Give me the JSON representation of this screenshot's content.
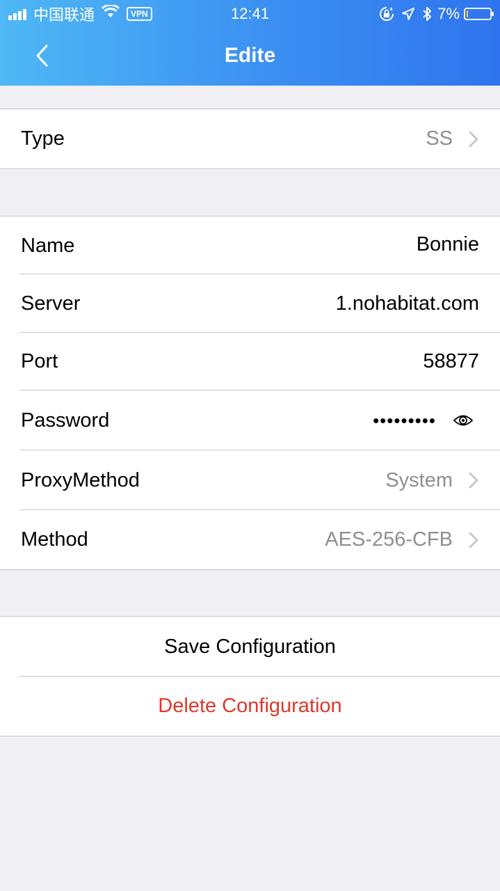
{
  "status_bar": {
    "carrier": "中国联通",
    "vpn": "VPN",
    "time": "12:41",
    "battery": "7%",
    "battery_level": 0.07,
    "battery_color": "#f7d341"
  },
  "nav": {
    "title": "Edite",
    "back_icon": "chevron-left-icon"
  },
  "type_row": {
    "label": "Type",
    "value": "SS"
  },
  "fields": {
    "name": {
      "label": "Name",
      "value": "Bonnie"
    },
    "server": {
      "label": "Server",
      "value": "1.nohabitat.com"
    },
    "port": {
      "label": "Port",
      "value": "58877"
    },
    "password": {
      "label": "Password",
      "value": "•••••••••",
      "toggle_icon": "eye-icon"
    },
    "proxy_method": {
      "label": "ProxyMethod",
      "value": "System"
    },
    "method": {
      "label": "Method",
      "value": "AES-256-CFB"
    }
  },
  "actions": {
    "save": "Save Configuration",
    "delete": "Delete Configuration"
  },
  "colors": {
    "header_start": "#4fb8f5",
    "header_end": "#2f74ee",
    "delete": "#e0382b",
    "secondary_text": "#8e8e93",
    "background": "#efeff4"
  }
}
